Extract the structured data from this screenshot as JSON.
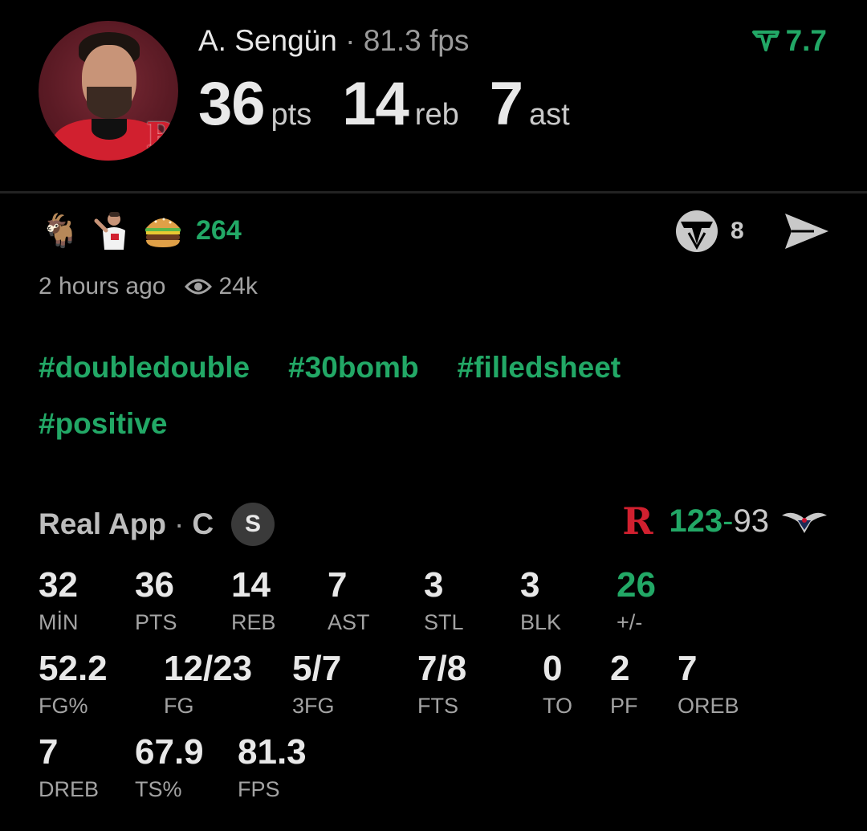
{
  "player": {
    "name": "A. Sengün",
    "separator": "·",
    "fps_text": "81.3 fps",
    "rating": "7.7",
    "pts": "36",
    "pts_unit": "pts",
    "reb": "14",
    "reb_unit": "reb",
    "ast": "7",
    "ast_unit": "ast"
  },
  "reactions": {
    "emojis": [
      "goat",
      "player-pose",
      "burger"
    ],
    "count": "264",
    "comments": "8"
  },
  "meta": {
    "time": "2 hours ago",
    "views": "24k"
  },
  "tags": [
    "#doubledouble",
    "#30bomb",
    "#filledsheet",
    "#positive"
  ],
  "game": {
    "source": "Real App",
    "sep": "·",
    "position": "C",
    "badge": "S",
    "home_score": "123",
    "dash": "-",
    "away_score": "93"
  },
  "stats": [
    {
      "value": "32",
      "label": "MİN"
    },
    {
      "value": "36",
      "label": "PTS"
    },
    {
      "value": "14",
      "label": "REB"
    },
    {
      "value": "7",
      "label": "AST"
    },
    {
      "value": "3",
      "label": "STL"
    },
    {
      "value": "3",
      "label": "BLK"
    },
    {
      "value": "26",
      "label": "+/-"
    },
    {
      "value": "52.2",
      "label": "FG%"
    },
    {
      "value": "12/23",
      "label": "FG"
    },
    {
      "value": "5/7",
      "label": "3FG"
    },
    {
      "value": "7/8",
      "label": "FTS"
    },
    {
      "value": "0",
      "label": "TO"
    },
    {
      "value": "2",
      "label": "PF"
    },
    {
      "value": "7",
      "label": "OREB"
    },
    {
      "value": "7",
      "label": "DREB"
    },
    {
      "value": "67.9",
      "label": "TS%"
    },
    {
      "value": "81.3",
      "label": "FPS"
    }
  ],
  "colors": {
    "accent_green": "#22a866",
    "rockets_red": "#d1202f",
    "background": "#000000"
  }
}
